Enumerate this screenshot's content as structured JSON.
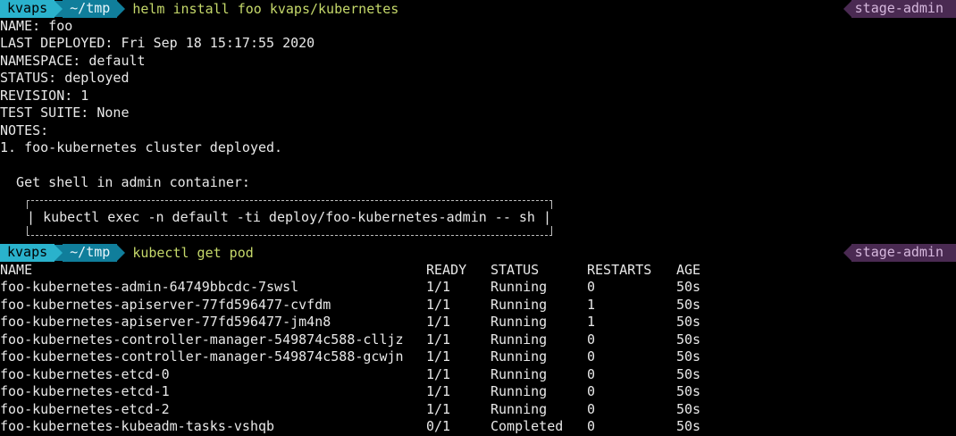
{
  "prompt1": {
    "user": "kvaps",
    "path": "~/tmp",
    "command": "helm install foo kvaps/kubernetes",
    "context": "stage-admin"
  },
  "helm_output": [
    "NAME: foo",
    "LAST DEPLOYED: Fri Sep 18 15:17:55 2020",
    "NAMESPACE: default",
    "STATUS: deployed",
    "REVISION: 1",
    "TEST SUITE: None",
    "NOTES:",
    "1. foo-kubernetes cluster deployed.",
    "",
    "  Get shell in admin container:"
  ],
  "notes_box": {
    "left_bar": "|",
    "command": "kubectl exec -n default -ti deploy/foo-kubernetes-admin -- sh",
    "right_bar": "|"
  },
  "prompt2": {
    "user": "kvaps",
    "path": "~/tmp",
    "command": "kubectl get pod",
    "context": "stage-admin"
  },
  "pods_table": {
    "headers": [
      "NAME",
      "READY",
      "STATUS",
      "RESTARTS",
      "AGE"
    ],
    "rows": [
      [
        "foo-kubernetes-admin-64749bbcdc-7swsl",
        "1/1",
        "Running",
        "0",
        "50s"
      ],
      [
        "foo-kubernetes-apiserver-77fd596477-cvfdm",
        "1/1",
        "Running",
        "1",
        "50s"
      ],
      [
        "foo-kubernetes-apiserver-77fd596477-jm4n8",
        "1/1",
        "Running",
        "1",
        "50s"
      ],
      [
        "foo-kubernetes-controller-manager-549874c588-clljz",
        "1/1",
        "Running",
        "0",
        "50s"
      ],
      [
        "foo-kubernetes-controller-manager-549874c588-gcwjn",
        "1/1",
        "Running",
        "0",
        "50s"
      ],
      [
        "foo-kubernetes-etcd-0",
        "1/1",
        "Running",
        "0",
        "50s"
      ],
      [
        "foo-kubernetes-etcd-1",
        "1/1",
        "Running",
        "0",
        "50s"
      ],
      [
        "foo-kubernetes-etcd-2",
        "1/1",
        "Running",
        "0",
        "50s"
      ],
      [
        "foo-kubernetes-kubeadm-tasks-vshqb",
        "0/1",
        "Completed",
        "0",
        "50s"
      ]
    ]
  },
  "colors": {
    "background": "#000000",
    "foreground": "#e8e8e8",
    "user_segment": "#2ab2cc",
    "path_segment": "#107e9b",
    "command": "#c5d86a",
    "context_segment": "#4a2a52",
    "context_text": "#d6b8dd"
  }
}
